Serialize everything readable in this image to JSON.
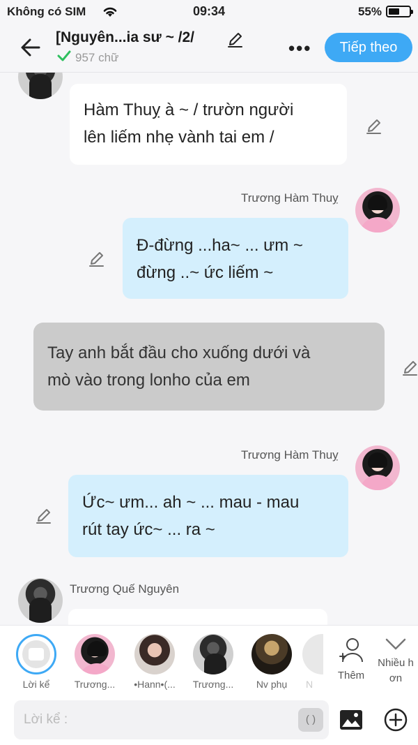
{
  "status_bar": {
    "carrier": "Không có SIM",
    "time": "09:34",
    "battery_percent_label": "55%",
    "battery_level": 0.55
  },
  "header": {
    "title": "[Nguyên...ia sư ~ /2/",
    "word_count": "957 chữ",
    "next_button": "Tiếp theo"
  },
  "messages": [
    {
      "sender": "",
      "side": "left",
      "style": "white",
      "lines": [
        "Hàm Thuỵ à ~ / trườn người",
        "lên liếm nhẹ vành tai em /"
      ]
    },
    {
      "sender": "Trương Hàm Thuỵ",
      "side": "right",
      "style": "blue",
      "lines": [
        "Đ-đừng ...ha~ ... ưm ~",
        "đừng ..~ ức liếm ~"
      ]
    },
    {
      "sender": "",
      "side": "narration",
      "style": "gray",
      "lines": [
        "Tay anh bắt đầu cho xuống dưới và",
        "mò vào trong lonho của em"
      ]
    },
    {
      "sender": "Trương Hàm Thuỵ",
      "side": "right",
      "style": "blue",
      "lines": [
        "Ức~ ưm... ah ~ ... mau - mau",
        "rút tay ức~ ... ra ~"
      ]
    },
    {
      "sender": "Trương Quế Nguyên",
      "side": "left",
      "style": "white",
      "lines": []
    }
  ],
  "characters": [
    {
      "label": "Lời kể",
      "icon": "narrator-icon"
    },
    {
      "label": "Trương...",
      "icon": "avatar-pink"
    },
    {
      "label": "•Hann•(...",
      "icon": "avatar-girl"
    },
    {
      "label": "Trương...",
      "icon": "avatar-dark"
    },
    {
      "label": "Nv phụ",
      "icon": "avatar-dim"
    },
    {
      "label": "N",
      "icon": "avatar-ghost"
    }
  ],
  "add_character_label": "Thêm",
  "more_label_line1": "Nhiều h",
  "more_label_line2": "ơn",
  "input": {
    "placeholder": "Lời kể :",
    "paren_button": "( )"
  },
  "colors": {
    "accent": "#3ea9f5",
    "bubble_blue": "#d4effd",
    "bubble_gray": "#cbcbcb",
    "bubble_white": "#ffffff"
  }
}
